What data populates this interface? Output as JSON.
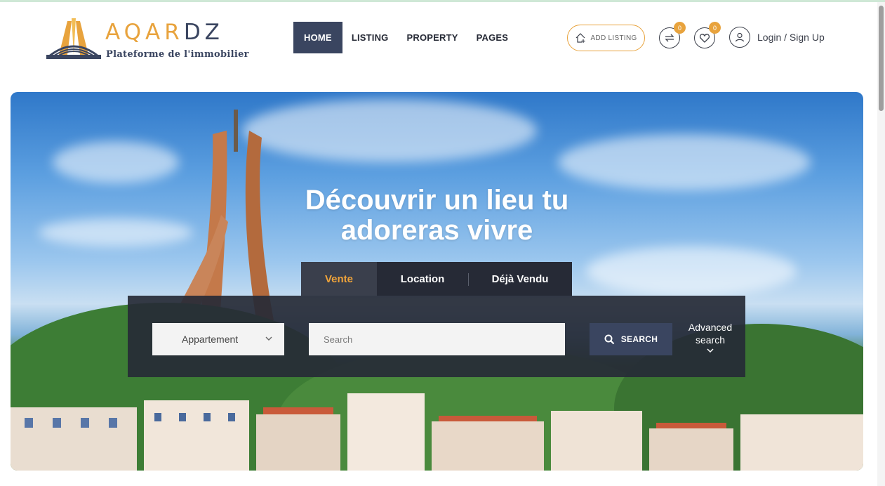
{
  "brand": {
    "name_main": "AQAR",
    "name_suffix": "DZ",
    "tagline": "Plateforme de l'immobilier"
  },
  "nav": {
    "items": [
      {
        "label": "HOME",
        "active": true
      },
      {
        "label": "LISTING",
        "active": false
      },
      {
        "label": "PROPERTY",
        "active": false
      },
      {
        "label": "PAGES",
        "active": false
      }
    ]
  },
  "header_actions": {
    "add_listing": "ADD LISTING",
    "compare_count": "0",
    "favorites_count": "0",
    "login": "Login / Sign Up"
  },
  "hero": {
    "title_line1": "Découvrir un lieu tu",
    "title_line2": "adoreras vivre"
  },
  "search": {
    "tabs": [
      {
        "label": "Vente",
        "active": true
      },
      {
        "label": "Location",
        "active": false
      },
      {
        "label": "Déjà Vendu",
        "active": false
      }
    ],
    "type_select": "Appartement",
    "placeholder": "Search",
    "button": "SEARCH",
    "advanced_line1": "Advanced",
    "advanced_line2": "search"
  },
  "colors": {
    "accent": "#e8a33d",
    "navy": "#3a4560",
    "dark": "#262a36"
  }
}
